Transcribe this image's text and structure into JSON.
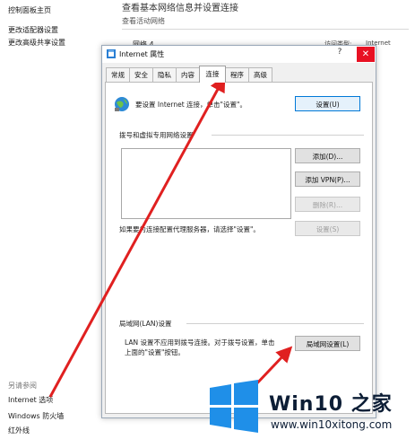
{
  "control_panel": {
    "left_links": [
      "控制面板主页",
      "更改适配器设置",
      "更改高级共享设置"
    ],
    "heading": "查看基本网络信息并设置连接",
    "subheading": "查看活动网络",
    "network_name": "网络 4",
    "access_type_label": "访问类型:",
    "access_type_value": "Internet",
    "see_also_label": "另请参阅",
    "see_also_links": [
      "Internet 选项",
      "Windows 防火墙",
      "红外线"
    ]
  },
  "dialog": {
    "title": "Internet 属性",
    "help_label": "?",
    "close_label": "✕",
    "tabs": [
      {
        "label": "常规"
      },
      {
        "label": "安全"
      },
      {
        "label": "隐私"
      },
      {
        "label": "内容"
      },
      {
        "label": "连接"
      },
      {
        "label": "程序"
      },
      {
        "label": "高级"
      }
    ],
    "active_tab": "连接",
    "setup_text": "要设置 Internet 连接，单击\"设置\"。",
    "setup_button": "设置(U)",
    "dialup_group_label": "拨号和虚拟专用网络设置",
    "add_button": "添加(D)...",
    "add_vpn_button": "添加 VPN(P)...",
    "delete_button": "删除(R)...",
    "proxy_text": "如果要为连接配置代理服务器，请选择\"设置\"。",
    "settings_button": "设置(S)",
    "lan_group_label": "局域网(LAN)设置",
    "lan_text_line1": "LAN 设置不应用到拨号连接。对于拨号设置，单击",
    "lan_text_line2": "上面的\"设置\"按钮。",
    "lan_settings_button": "局域网设置(L)"
  },
  "watermark": {
    "brand": "Win10 之家",
    "url": "www.win10xitong.com"
  },
  "colors": {
    "arrow": "#e02020",
    "close": "#e81123",
    "accent": "#0078d7",
    "logo": "#1f8fe8"
  }
}
